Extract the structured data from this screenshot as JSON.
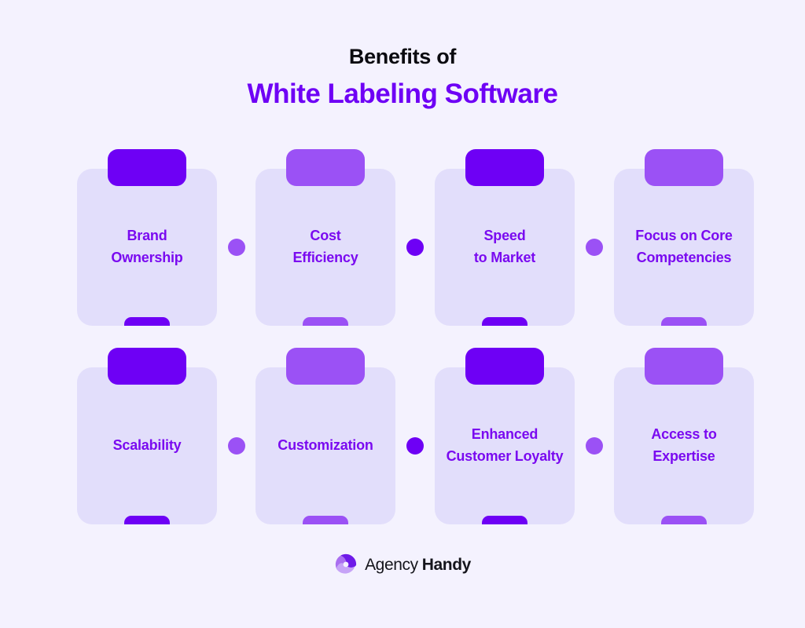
{
  "heading": {
    "line1": "Benefits of",
    "line2": "White Labeling Software"
  },
  "colors": {
    "background": "#f4f2fe",
    "card_background": "#e2defb",
    "accent_dark": "#6e00f5",
    "accent_light": "#9b51f5",
    "label_text": "#7a0af0",
    "heading_dark": "#0b0b10",
    "logo_text": "#15151c"
  },
  "cards": [
    {
      "label": "Brand\nOwnership",
      "tab_color": "#6e00f5",
      "tab_tone": "dark",
      "row": 1,
      "col": 1
    },
    {
      "label": "Cost\nEfficiency",
      "tab_color": "#9b51f5",
      "tab_tone": "light",
      "row": 1,
      "col": 2
    },
    {
      "label": "Speed\nto Market",
      "tab_color": "#6e00f5",
      "tab_tone": "dark",
      "row": 1,
      "col": 3
    },
    {
      "label": "Focus on Core\nCompetencies",
      "tab_color": "#9b51f5",
      "tab_tone": "light",
      "row": 1,
      "col": 4
    },
    {
      "label": "Scalability",
      "tab_color": "#6e00f5",
      "tab_tone": "dark",
      "row": 2,
      "col": 1
    },
    {
      "label": "Customization",
      "tab_color": "#9b51f5",
      "tab_tone": "light",
      "row": 2,
      "col": 2
    },
    {
      "label": "Enhanced\nCustomer Loyalty",
      "tab_color": "#6e00f5",
      "tab_tone": "dark",
      "row": 2,
      "col": 3
    },
    {
      "label": "Access to\nExpertise",
      "tab_color": "#9b51f5",
      "tab_tone": "light",
      "row": 2,
      "col": 4
    }
  ],
  "connector_dots": [
    {
      "color": "#9b51f5",
      "row": 1,
      "after_col": 1
    },
    {
      "color": "#6e00f5",
      "row": 1,
      "after_col": 2
    },
    {
      "color": "#9b51f5",
      "row": 1,
      "after_col": 3
    },
    {
      "color": "#9b51f5",
      "row": 2,
      "after_col": 1
    },
    {
      "color": "#6e00f5",
      "row": 2,
      "after_col": 2
    },
    {
      "color": "#9b51f5",
      "row": 2,
      "after_col": 3
    }
  ],
  "logo": {
    "icon": "agency-handy-pinwheel-icon",
    "name_light": "Agency",
    "name_bold": "Handy",
    "mark_color_light": "#a96ef0",
    "mark_color_dark": "#6e1ae8"
  }
}
